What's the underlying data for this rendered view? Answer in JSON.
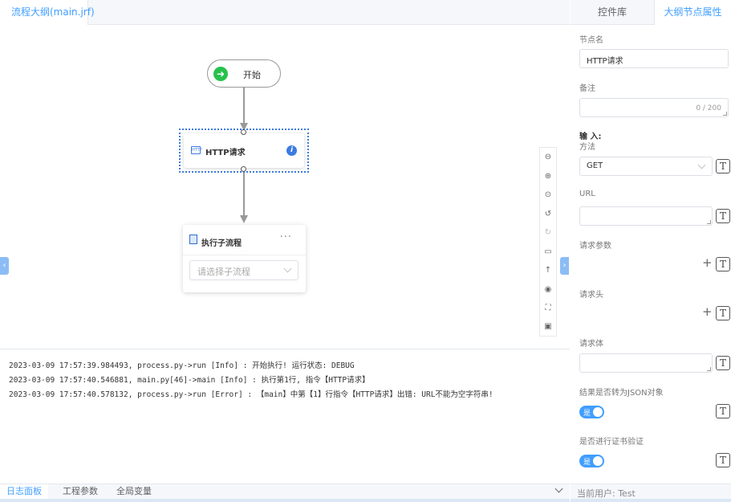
{
  "editor": {
    "tab_title": "流程大纲(main.jrf)"
  },
  "flow": {
    "start_label": "开始",
    "http_label": "HTTP请求",
    "http_icon_text": "HTTP",
    "subflow_label": "执行子流程",
    "subflow_more": "···",
    "subflow_placeholder": "请选择子流程"
  },
  "toolbar_icons": [
    "zoom-out-icon",
    "zoom-in-icon",
    "locate-icon",
    "undo-icon",
    "redo-icon",
    "clear-icon",
    "up-arrow-icon",
    "preview-icon",
    "fullscreen-icon",
    "image-icon"
  ],
  "logs": [
    "2023-03-09 17:57:39.984493, process.py->run [Info] : 开始执行! 运行状态: DEBUG",
    "2023-03-09 17:57:40.546881, main.py[46]->main [Info] : 执行第1行, 指令【HTTP请求】",
    "2023-03-09 17:57:40.578132, process.py->run [Error] : 【main】中第【1】行指令【HTTP请求】出错: URL不能为空字符串!"
  ],
  "bottom_tabs": {
    "log_panel": "日志面板",
    "project_params": "工程参数",
    "global_vars": "全局变量"
  },
  "right_panel": {
    "tab_controls": "控件库",
    "tab_outline_props": "大纲节点属性",
    "node_name_label": "节点名",
    "node_name_value": "HTTP请求",
    "remark_label": "备注",
    "remark_counter": "0 / 200",
    "input_label": "输 入:",
    "method_label": "方法",
    "method_value": "GET",
    "url_label": "URL",
    "params_label": "请求参数",
    "headers_label": "请求头",
    "body_label": "请求体",
    "json_label": "结果是否转为JSON对象",
    "json_toggle": "是",
    "cert_label": "是否进行证书验证",
    "cert_toggle": "是",
    "current_user": "当前用户: Test",
    "t_symbol": "T",
    "plus_symbol": "+"
  },
  "colors": {
    "accent": "#409eff",
    "start_green": "#27c24c",
    "selection": "#3c7be0"
  }
}
